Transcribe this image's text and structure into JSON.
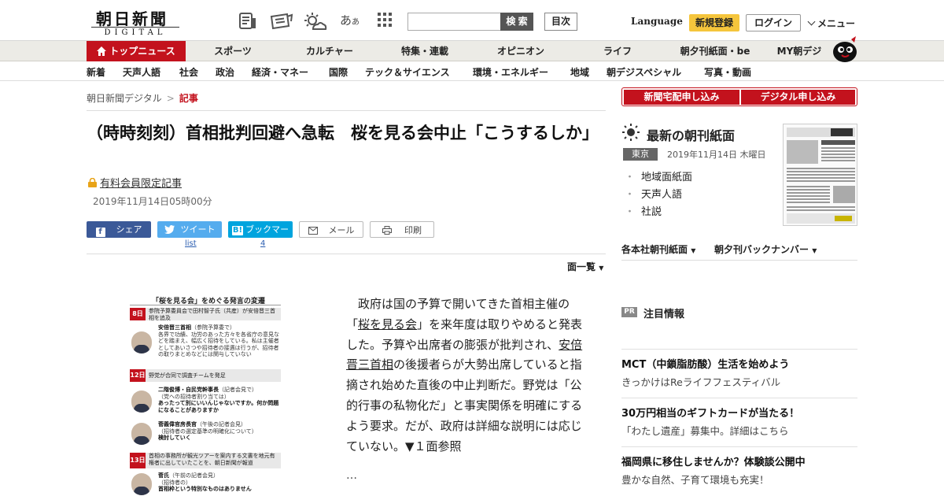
{
  "header": {
    "logo_main": "朝日新聞",
    "logo_sub": "DIGITAL",
    "search_button": "検 索",
    "mokuji": "目次",
    "language": "Language",
    "register": "新規登録",
    "login": "ログイン",
    "menu": "メニュー"
  },
  "global_nav": [
    "トップニュース",
    "スポーツ",
    "カルチャー",
    "特集・連載",
    "オピニオン",
    "ライフ",
    "朝夕刊紙面・be",
    "MY朝デジ"
  ],
  "sub_nav": [
    "新着",
    "天声人語",
    "社会",
    "政治",
    "経済・マネー",
    "国際",
    "テック＆サイエンス",
    "環境・エネルギー",
    "地域",
    "朝デジスペシャル",
    "写真・動画"
  ],
  "breadcrumb": {
    "root": "朝日新聞デジタル",
    "sep": ">",
    "current": "記事"
  },
  "article": {
    "title": "（時時刻刻）首相批判回避へ急転　桜を見る会中止「こうするしか」",
    "paid": "有料会員限定記事",
    "date": "2019年11月14日05時00分",
    "share": {
      "facebook": "シェア",
      "twitter": "ツイート",
      "hatena": "ブックマーク",
      "mail": "メール",
      "print": "印刷"
    },
    "share_counts": {
      "twitter": "list",
      "hatena": "4"
    },
    "menlist": "面一覧",
    "body_1": "政府は国の予算で開いてきた首相主催の「",
    "body_link1": "桜を見る会",
    "body_2": "」を来年度は取りやめると発表した。予算や出席者の膨張が批判され、",
    "body_link2": "安倍晋三首相",
    "body_3": "の後援者らが大勢出席していると指摘され始めた直後の中止判断だ。野党は「公的行事の私物化だ」と事実関係を明確にするよう要求。だが、政府は詳細な説明には応じていない。▼１面参照",
    "ellipsis": "…"
  },
  "figure": {
    "title": "「桜を見る会」をめぐる発言の変遷",
    "d1_day": "8日",
    "d1_text": "参院予算委員会で田村智子氏（共産）が安倍晋三首相を追及",
    "q1_head": "安倍晋三首相",
    "q1_note": "（参院予算委で）",
    "q1_text": "各界で功績、功労のあった方々を各省庁の意見などを踏まえ、幅広く招待をしている。私は主催者としてあいさつや招待者の接遇は行うが、招待者の取りまとめなどには関与していない",
    "d2_day": "12日",
    "d2_text": "野党が合同で調査チームを発足",
    "q2_head": "二階俊博・自民党幹事長",
    "q2_note": "（記者会見で）",
    "q2_sub": "（党への招待者割り当ては）",
    "q2_text": "あったって別にいいんじゃないですか。何か問題になることがありますか",
    "q3_head": "菅義偉官房長官",
    "q3_note": "（午後の記者会見）",
    "q3_sub": "（招待者の選定基準の明確化について）",
    "q3_text": "検討していく",
    "d3_day": "13日",
    "d3_text": "首相の事務所が観光ツアーを案内する文書を地元有権者に出していたことを、朝日新聞が報道",
    "q4_head": "菅氏",
    "q4_note": "（午前の記者会見）",
    "q4_sub": "（招待者の）",
    "q4_text": "首相枠という特別なものはありません"
  },
  "sidebar": {
    "btn1": "新聞宅配申し込み",
    "btn2": "デジタル申し込み",
    "choukan_title": "最新の朝刊紙面",
    "region": "東京",
    "choukan_date": "2019年11月14日 木曜日",
    "links": [
      "地域面紙面",
      "天声人語",
      "社説"
    ],
    "drop1": "各本社朝刊紙面",
    "drop2": "朝夕刊バックナンバー",
    "pr_badge": "PR",
    "pr_title": "注目情報",
    "ads": [
      {
        "head": "MCT（中鎖脂肪酸）生活を始めよう",
        "sub": "きっかけはReライフフェスティバル"
      },
      {
        "head": "30万円相当のギフトカードが当たる！",
        "sub": "「わたし遺産」募集中。詳細はこちら"
      },
      {
        "head": "福岡県に移住しませんか？体験談公開中",
        "sub": "豊かな自然、子育て環境も充実！"
      }
    ]
  },
  "colors": {
    "accent": "#c3121d",
    "register": "#f5c53c",
    "facebook": "#3b5998",
    "twitter": "#55acee",
    "hatena": "#00a4de"
  }
}
